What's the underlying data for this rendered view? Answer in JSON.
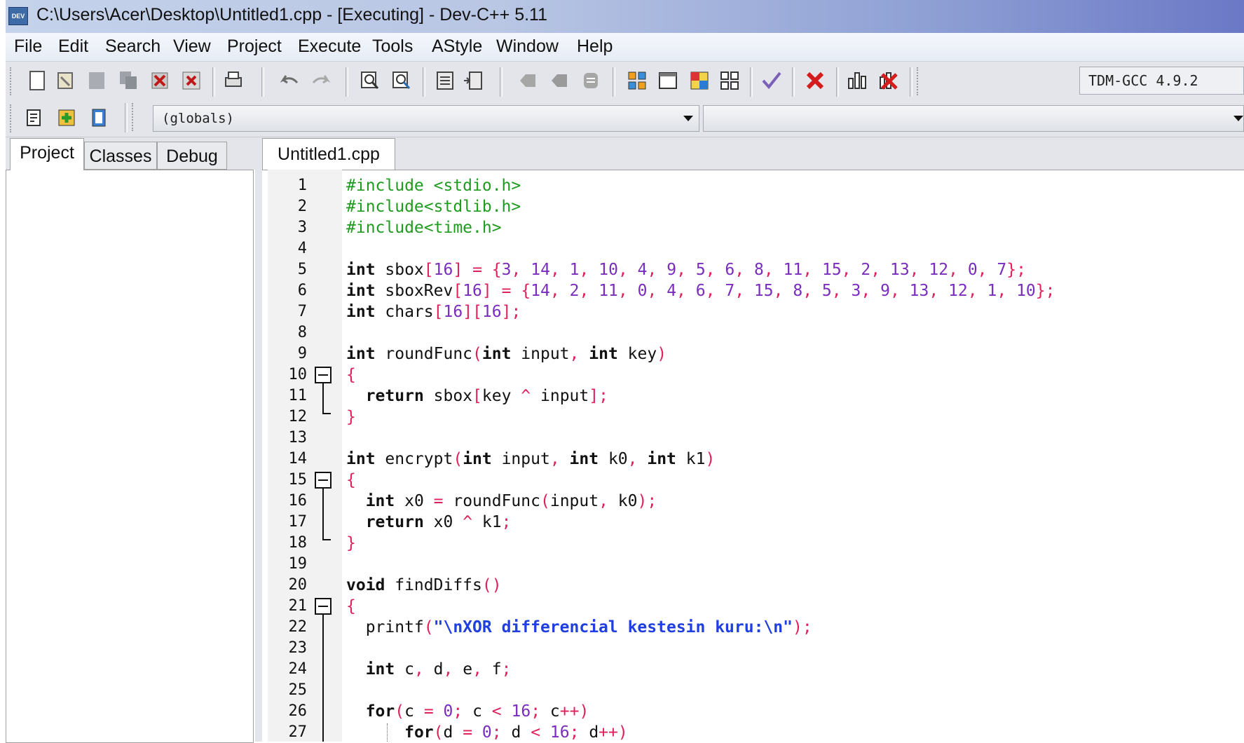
{
  "window": {
    "title": "C:\\Users\\Acer\\Desktop\\Untitled1.cpp - [Executing] - Dev-C++ 5.11",
    "app_icon_label": "DEV"
  },
  "menu": [
    "File",
    "Edit",
    "Search",
    "View",
    "Project",
    "Execute",
    "Tools",
    "AStyle",
    "Window",
    "Help"
  ],
  "toolbar": {
    "compiler": "TDM-GCC 4.9.2",
    "icons": [
      "new-file",
      "open",
      "save",
      "save-all",
      "close",
      "close-all",
      "print",
      "undo",
      "redo",
      "find",
      "replace",
      "goto",
      "indent",
      "unindent",
      "toggle-bookmark",
      "goto-bookmark",
      "compile",
      "run",
      "compile-run",
      "rebuild",
      "syntax-check",
      "stop",
      "profile",
      "delete-profile",
      "new-project",
      "add-to-project",
      "remove-from-project"
    ]
  },
  "scope": {
    "globals": "(globals)",
    "class": ""
  },
  "left_panel": {
    "tabs": [
      "Project",
      "Classes",
      "Debug"
    ],
    "active": "Project"
  },
  "editor": {
    "tab": "Untitled1.cpp",
    "line_numbers": [
      "1",
      "2",
      "3",
      "4",
      "5",
      "6",
      "7",
      "8",
      "9",
      "10",
      "11",
      "12",
      "13",
      "14",
      "15",
      "16",
      "17",
      "18",
      "19",
      "20",
      "21",
      "22",
      "23",
      "24",
      "25",
      "26",
      "27"
    ],
    "lines": [
      "#include <stdio.h>",
      "#include<stdlib.h>",
      "#include<time.h>",
      "",
      "int sbox[16] = {3, 14, 1, 10, 4, 9, 5, 6, 8, 11, 15, 2, 13, 12, 0, 7};",
      "int sboxRev[16] = {14, 2, 11, 0, 4, 6, 7, 15, 8, 5, 3, 9, 13, 12, 1, 10};",
      "int chars[16][16];",
      "",
      "int roundFunc(int input, int key)",
      "{",
      "  return sbox[key ^ input];",
      "}",
      "",
      "int encrypt(int input, int k0, int k1)",
      "{",
      "  int x0 = roundFunc(input, k0);",
      "  return x0 ^ k1;",
      "}",
      "",
      "void findDiffs()",
      "{",
      "  printf(\"\\nXOR differencial kestesin kuru:\\n\");",
      "",
      "  int c, d, e, f;",
      "",
      "  for(c = 0; c < 16; c++)",
      "      for(d = 0; d < 16; d++)"
    ]
  },
  "colors": {
    "preprocessor": "#1f9b1f",
    "keyword": "#111111",
    "symbol": "#e0205a",
    "number": "#7a2dbd",
    "string": "#1f3fe0"
  }
}
